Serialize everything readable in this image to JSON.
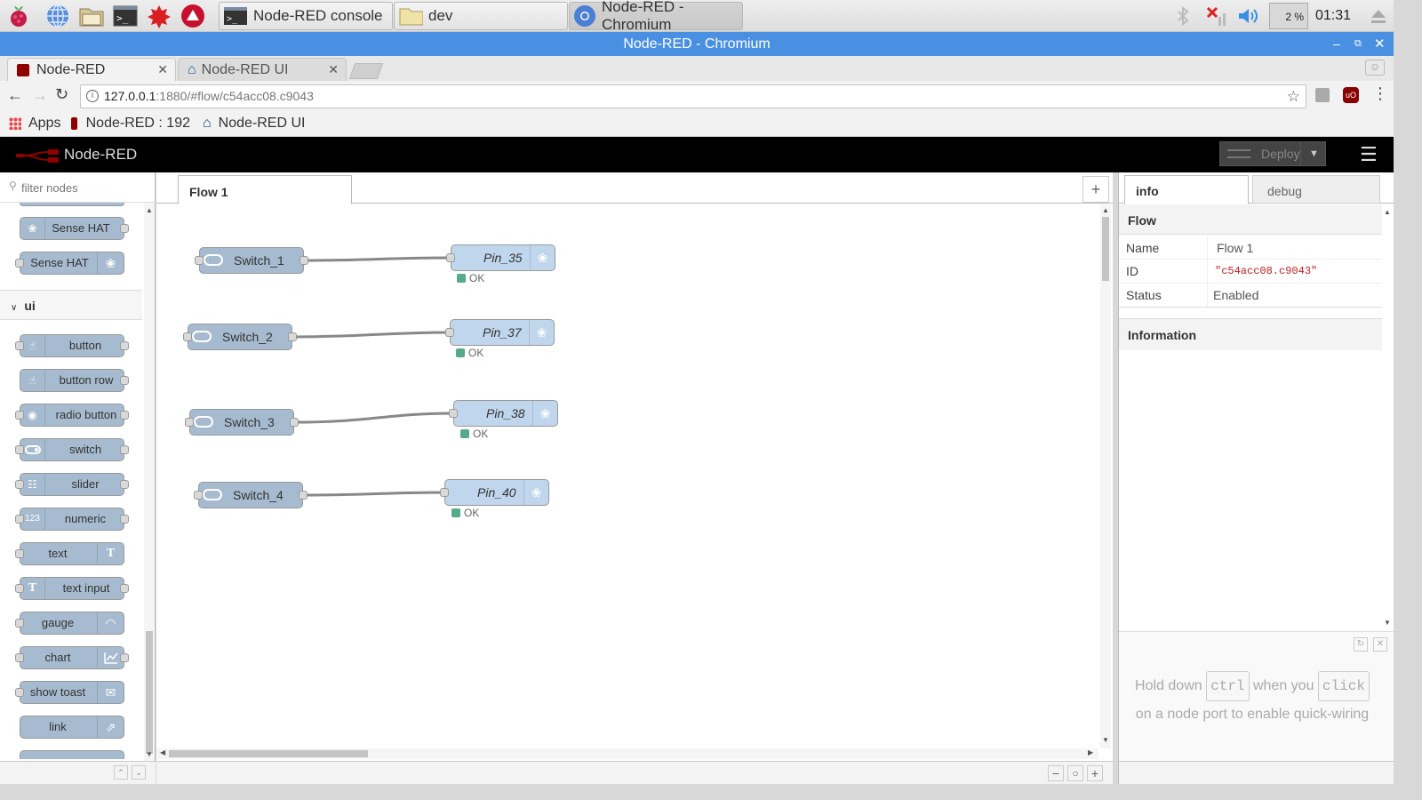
{
  "taskbar": {
    "tasks": [
      {
        "label": "Node-RED console"
      },
      {
        "label": "dev"
      },
      {
        "label": "Node-RED - Chromium"
      }
    ],
    "cpu": "2 %",
    "clock": "01:31"
  },
  "browser": {
    "window_title": "Node-RED - Chromium",
    "tabs": [
      {
        "label": "Node-RED"
      },
      {
        "label": "Node-RED UI"
      }
    ],
    "url_host": "127.0.0.1",
    "url_rest": ":1880/#flow/c54acc08.c9043",
    "bookmarks": [
      {
        "label": "Apps"
      },
      {
        "label": "Node-RED : 192"
      },
      {
        "label": "Node-RED UI"
      }
    ]
  },
  "nodered": {
    "logo_text": "Node-RED",
    "deploy_label": "Deploy",
    "palette": {
      "filter_placeholder": "filter nodes",
      "category": "ui",
      "top_nodes": [
        {
          "label": "Sense HAT"
        },
        {
          "label": "Sense HAT"
        }
      ],
      "ui_nodes": [
        {
          "label": "button",
          "icon": "hand-pointer-icon"
        },
        {
          "label": "button row",
          "icon": "hand-pointer-icon"
        },
        {
          "label": "radio button",
          "icon": "radio-icon"
        },
        {
          "label": "switch",
          "icon": "toggle-icon"
        },
        {
          "label": "slider",
          "icon": "slider-icon"
        },
        {
          "label": "numeric",
          "icon": "numeric-icon",
          "icon_text": "123"
        },
        {
          "label": "text",
          "icon": "text-icon"
        },
        {
          "label": "text input",
          "icon": "text-icon"
        },
        {
          "label": "gauge",
          "icon": "gauge-icon"
        },
        {
          "label": "chart",
          "icon": "chart-icon"
        },
        {
          "label": "show toast",
          "icon": "envelope-icon"
        },
        {
          "label": "link",
          "icon": "external-link-icon"
        }
      ]
    },
    "flow_tab": "Flow 1",
    "flow": {
      "switches": [
        {
          "label": "Switch_1"
        },
        {
          "label": "Switch_2"
        },
        {
          "label": "Switch_3"
        },
        {
          "label": "Switch_4"
        }
      ],
      "pins": [
        {
          "label": "Pin_35",
          "status": "OK"
        },
        {
          "label": "Pin_37",
          "status": "OK"
        },
        {
          "label": "Pin_38",
          "status": "OK"
        },
        {
          "label": "Pin_40",
          "status": "OK"
        }
      ]
    },
    "sidebar": {
      "tabs": [
        {
          "label": "info"
        },
        {
          "label": "debug"
        }
      ],
      "flow_heading": "Flow",
      "props": [
        {
          "key": "Name",
          "value": "Flow 1"
        },
        {
          "key": "ID",
          "value": "\"c54acc08.c9043\""
        },
        {
          "key": "Status",
          "value": "Enabled"
        }
      ],
      "info_heading": "Information",
      "tip": {
        "part1": "Hold down",
        "key1": "ctrl",
        "part2": "when you",
        "key2": "click",
        "part3": "on a node port to enable quick-wiring"
      }
    }
  }
}
